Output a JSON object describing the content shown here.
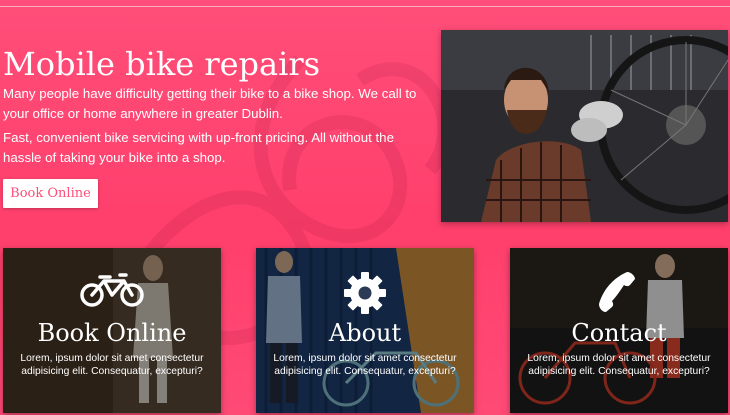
{
  "hero": {
    "title": "Mobile bike repairs",
    "paragraph_1": "Many people have difficulty getting their bike to a bike shop. We call to your office or home anywhere in greater Dublin.",
    "paragraph_2": "Fast, convenient bike servicing with up-front pricing. All without the hassle of taking your bike into a shop.",
    "button_label": "Book Online"
  },
  "cards": [
    {
      "title": "Book Online",
      "icon": "bicycle-icon",
      "text": "Lorem, ipsum dolor sit amet consectetur adipisicing elit. Consequatur, excepturi?"
    },
    {
      "title": "About",
      "icon": "gear-icon",
      "text": "Lorem, ipsum dolor sit amet consectetur adipisicing elit. Consequatur, excepturi?"
    },
    {
      "title": "Contact",
      "icon": "phone-icon",
      "text": "Lorem, ipsum dolor sit amet consectetur adipisicing elit. Consequatur, excepturi?"
    }
  ],
  "colors": {
    "accent": "#ff4e79",
    "text": "#ffffff"
  }
}
